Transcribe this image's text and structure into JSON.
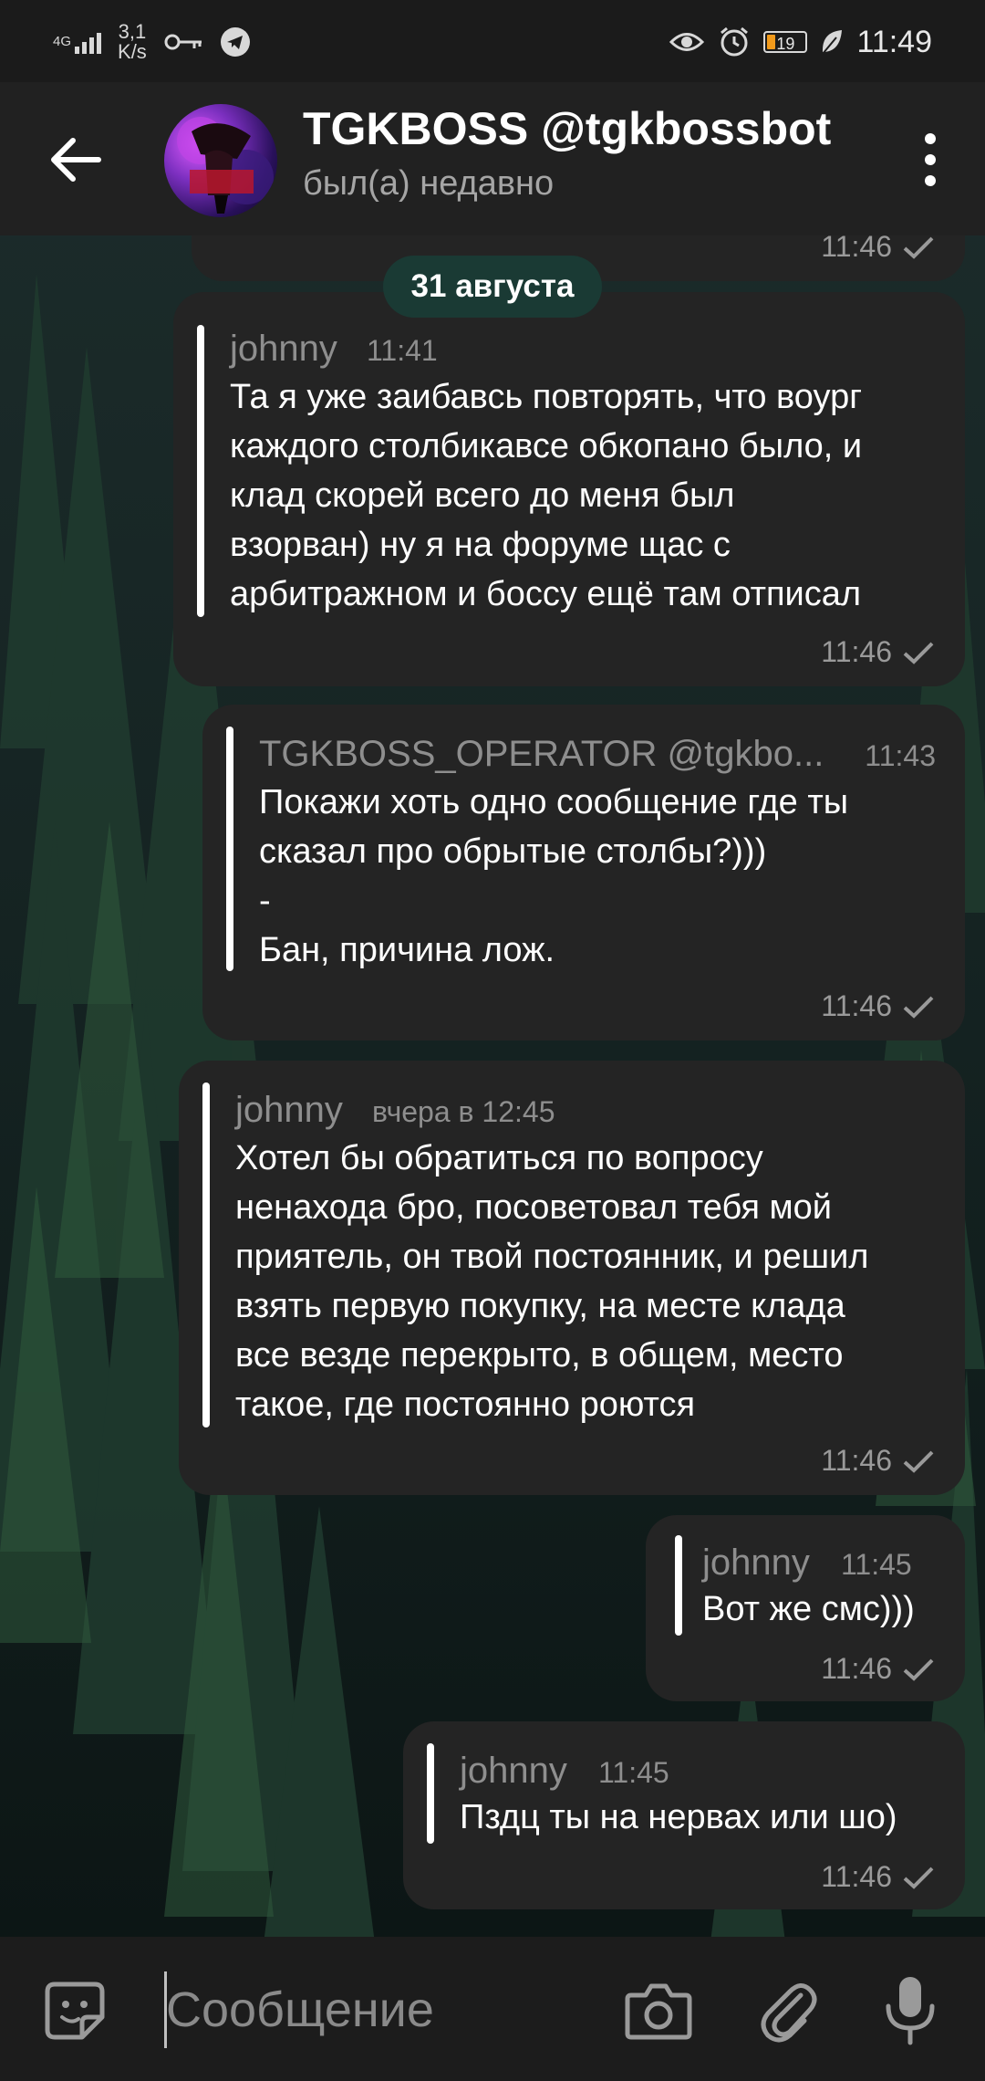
{
  "status_bar": {
    "network": "4G",
    "speed_value": "3,1",
    "speed_unit": "K/s",
    "battery": "19",
    "time": "11:49"
  },
  "header": {
    "title": "TGKBOSS @tgkbossbot",
    "subtitle": "был(а) недавно"
  },
  "top_message": {
    "time": "11:46"
  },
  "date_chip": "31 августа",
  "messages": [
    {
      "quote_name": "johnny",
      "quote_time": "11:41",
      "text": "Та я уже заибавсь повторять, что воург\nкаждого столбикавсе обкопано было, и\nклад скорей всего до меня был\nвзорван) ну я на форуме щас с\nарбитражном и боссу ещё там отписал",
      "time": "11:46"
    },
    {
      "quote_name": "TGKBOSS_OPERATOR @tgkbo...",
      "quote_time": "11:43",
      "text": "Покажи хоть одно сообщение где ты\nсказал про обрытые столбы?)))\n-\nБан, причина лож.",
      "time": "11:46"
    },
    {
      "quote_name": "johnny",
      "quote_time": "вчера в 12:45",
      "text": "Хотел бы обратиться по вопросу\nненахода бро, посоветовал тебя мой\nприятель, он твой постоянник, и решил\nвзять первую покупку, на месте клада\nвсе везде перекрыто, в общем, место\nтакое, где постоянно роются",
      "time": "11:46"
    },
    {
      "quote_name": "johnny",
      "quote_time": "11:45",
      "text": "Вот же смс)))",
      "time": "11:46"
    },
    {
      "quote_name": "johnny",
      "quote_time": "11:45",
      "text": "Пздц ты на нервах или шо)",
      "time": "11:46"
    }
  ],
  "input": {
    "placeholder": "Сообщение"
  },
  "colors": {
    "bubble": "#242424",
    "header": "#212121",
    "date_chip": "#1a3a34",
    "battery_fill": "#f19a1b"
  }
}
